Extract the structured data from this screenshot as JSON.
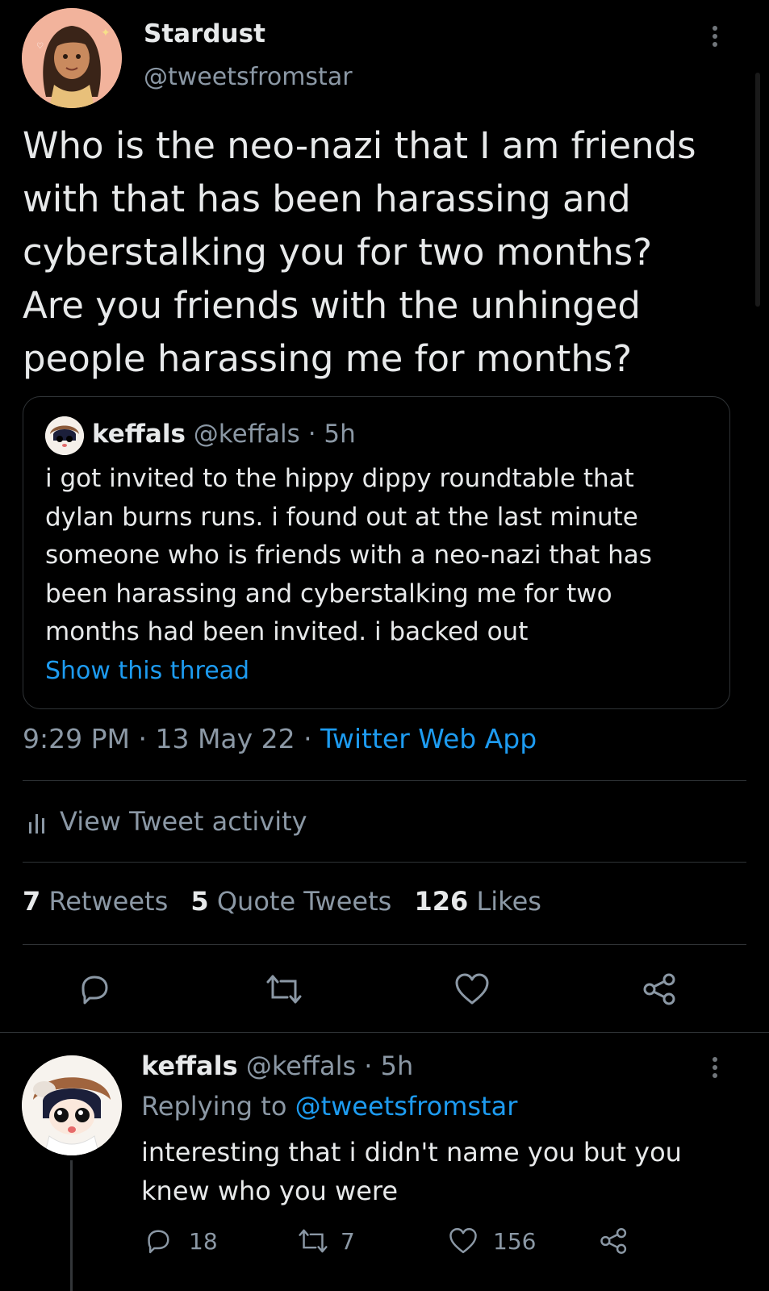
{
  "tweet": {
    "display_name": "Stardust",
    "handle": "@tweetsfromstar",
    "text_lines": [
      "Who is the neo-nazi that I am friends",
      "with that has been harassing and",
      "cyberstalking you for two months?",
      "Are you friends with the unhinged",
      "people harassing me for months?"
    ],
    "quote": {
      "display_name": "keffals",
      "handle": "@keffals",
      "separator": "·",
      "age": "5h",
      "text_lines": [
        "i got invited to the hippy dippy roundtable that",
        "dylan burns runs. i found out at the last minute",
        "someone who is friends with a neo-nazi that has",
        "been harassing and cyberstalking me for two",
        "months had been invited. i backed out"
      ],
      "show_thread": "Show this thread"
    },
    "time": "9:29 PM",
    "date": "13 May 22",
    "separator": "·",
    "source": "Twitter Web App",
    "activity_label": "View Tweet activity",
    "stats": {
      "retweets_count": "7",
      "retweets_label": "Retweets",
      "quotes_count": "5",
      "quotes_label": "Quote Tweets",
      "likes_count": "126",
      "likes_label": "Likes"
    }
  },
  "reply": {
    "display_name": "keffals",
    "handle": "@keffals",
    "separator": "·",
    "age": "5h",
    "replying_prefix": "Replying to",
    "replying_handle": "@tweetsfromstar",
    "text_lines": [
      "interesting that i didn't name you but you",
      "knew who you were"
    ],
    "counts": {
      "replies": "18",
      "retweets": "7",
      "likes": "156"
    }
  },
  "colors": {
    "background": "#000000",
    "accent": "#1d9bf0",
    "muted": "#8b98a5",
    "divider": "#2f3336"
  },
  "icons": [
    "more-icon",
    "reply-icon",
    "retweet-icon",
    "like-icon",
    "share-icon",
    "activity-icon"
  ]
}
